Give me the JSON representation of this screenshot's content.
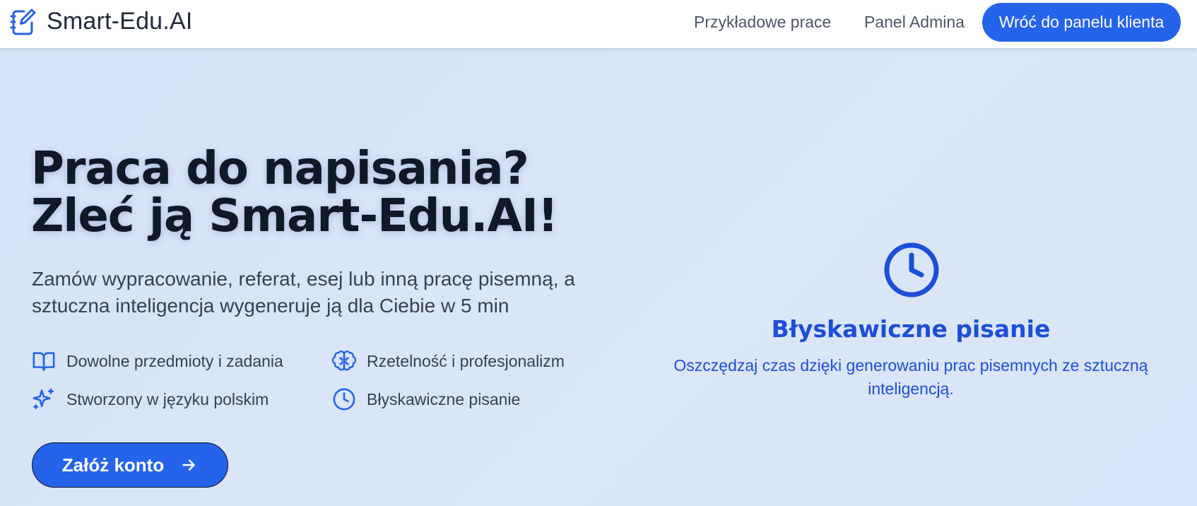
{
  "header": {
    "logo_text": "Smart-Edu.AI",
    "nav": {
      "examples": "Przykładowe prace",
      "admin": "Panel Admina",
      "client_panel_button": "Wróć do panelu klienta"
    }
  },
  "hero": {
    "title_line1": "Praca do napisania?",
    "title_line2": "Zleć ją Smart-Edu.AI!",
    "subtitle": "Zamów wypracowanie, referat, esej lub inną pracę pisemną, a sztuczna inteligencja wygeneruje ją dla Ciebie w 5 min",
    "features": [
      {
        "label": "Dowolne przedmioty i zadania",
        "icon": "book-open-icon"
      },
      {
        "label": "Rzetelność i profesjonalizm",
        "icon": "brain-icon"
      },
      {
        "label": "Stworzony w języku polskim",
        "icon": "sparkles-icon"
      },
      {
        "label": "Błyskawiczne pisanie",
        "icon": "clock-icon"
      }
    ],
    "cta_label": "Załóż konto"
  },
  "feature_card": {
    "icon": "clock-icon",
    "title": "Błyskawiczne pisanie",
    "description": "Oszczędzaj czas dzięki generowaniu prac pisemnych ze sztuczną inteligencją."
  },
  "colors": {
    "accent": "#2563eb",
    "accent_dark": "#1d4ed8",
    "heading": "#111827",
    "text": "#374151",
    "background": "#d9e5f7"
  }
}
